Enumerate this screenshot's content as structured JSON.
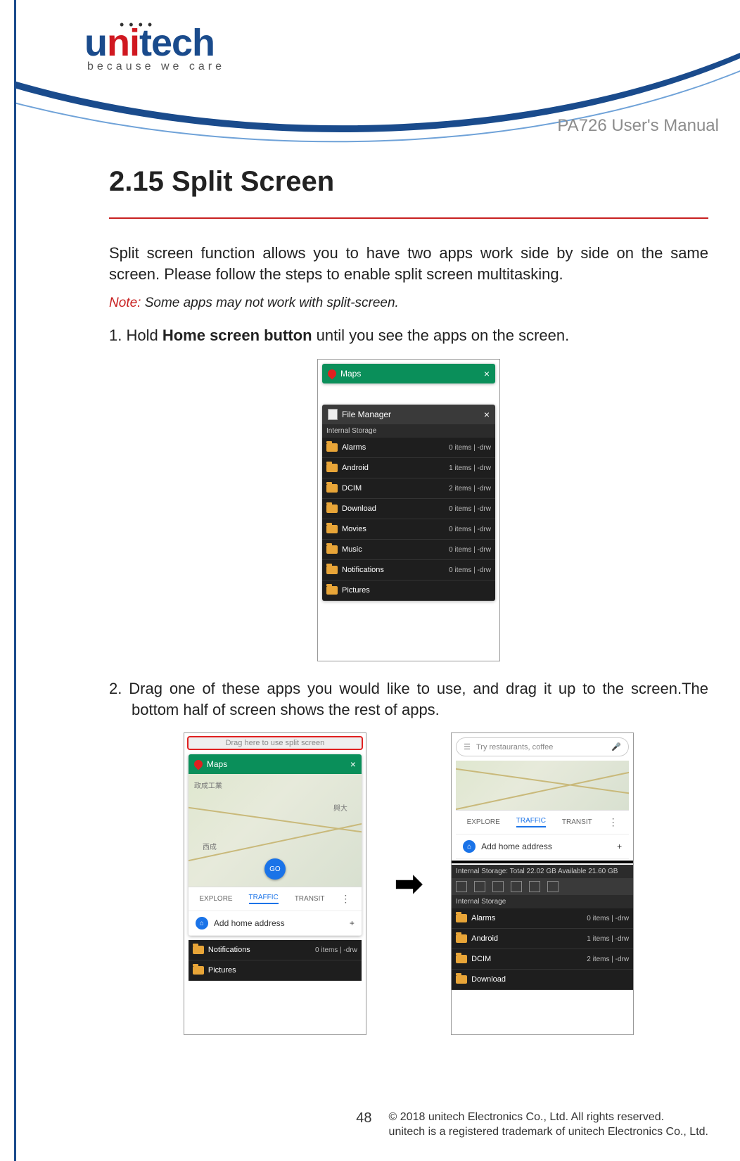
{
  "logo": {
    "u": "u",
    "ni": "ni",
    "tech": "tech",
    "dots": "• • • •",
    "tagline": "because we care"
  },
  "doc_title": "PA726 User's Manual",
  "heading": "2.15 Split Screen",
  "intro": "Split screen function allows you to have two apps work side by side on the same screen. Please follow the steps to enable split screen multitasking.",
  "note_label": "Note:",
  "note_text": " Some apps may not work with split-screen.",
  "step1_prefix": "1.  Hold ",
  "step1_bold": "Home screen button",
  "step1_suffix": " until you see the apps on the screen.",
  "step2": "2.  Drag one of these apps you would like to use, and drag it up to the screen.The bottom half of screen shows the rest of apps.",
  "shot1": {
    "maps_label": "Maps",
    "fm_label": "File Manager",
    "storage_label": "Internal Storage",
    "folders": [
      {
        "name": "Alarms",
        "meta": "0 items | -drw"
      },
      {
        "name": "Android",
        "meta": "1 items | -drw"
      },
      {
        "name": "DCIM",
        "meta": "2 items | -drw"
      },
      {
        "name": "Download",
        "meta": "0 items | -drw"
      },
      {
        "name": "Movies",
        "meta": "0 items | -drw"
      },
      {
        "name": "Music",
        "meta": "0 items | -drw"
      },
      {
        "name": "Notifications",
        "meta": "0 items | -drw"
      },
      {
        "name": "Pictures",
        "meta": ""
      }
    ]
  },
  "shot2": {
    "drag_banner": "Drag here to use split screen",
    "maps_label": "Maps",
    "go": "GO",
    "tabs": {
      "explore": "EXPLORE",
      "traffic": "TRAFFIC",
      "transit": "TRANSIT"
    },
    "add_home": "Add home address",
    "plus": "+",
    "folders": [
      {
        "name": "Notifications",
        "meta": "0 items | -drw"
      },
      {
        "name": "Pictures",
        "meta": ""
      }
    ]
  },
  "shot3": {
    "search_placeholder": "Try restaurants, coffee",
    "tabs": {
      "explore": "EXPLORE",
      "traffic": "TRAFFIC",
      "transit": "TRANSIT"
    },
    "add_home": "Add home address",
    "plus": "+",
    "storage_status": "Internal Storage:  Total 22.02 GB    Available 21.60 GB",
    "storage_label": "Internal Storage",
    "folders": [
      {
        "name": "Alarms",
        "meta": "0 items | -drw"
      },
      {
        "name": "Android",
        "meta": "1 items | -drw"
      },
      {
        "name": "DCIM",
        "meta": "2 items | -drw"
      },
      {
        "name": "Download",
        "meta": ""
      }
    ]
  },
  "arrow": "➡",
  "page_number": "48",
  "footer_line1": "© 2018 unitech Electronics Co., Ltd. All rights reserved.",
  "footer_line2": "unitech is a registered trademark of unitech Electronics Co., Ltd."
}
